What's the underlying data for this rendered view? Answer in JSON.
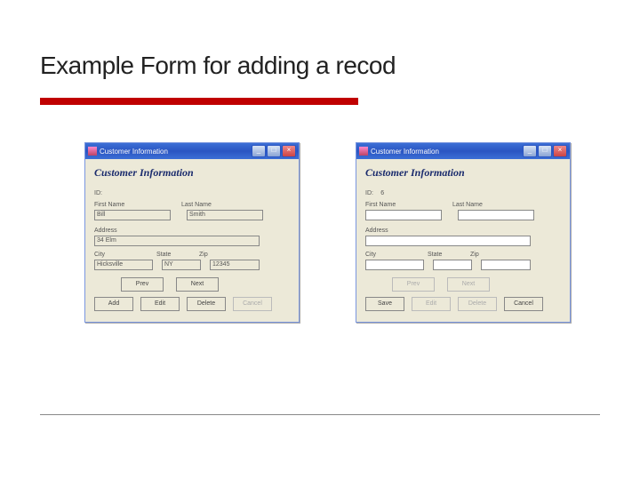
{
  "slide": {
    "title": "Example Form for adding a recod"
  },
  "leftForm": {
    "window_title": "Customer Information",
    "heading": "Customer Information",
    "labels": {
      "id": "ID:",
      "first_name": "First Name",
      "last_name": "Last Name",
      "address": "Address",
      "city": "City",
      "state": "State",
      "zip": "Zip"
    },
    "values": {
      "id": "",
      "first_name": "Bill",
      "last_name": "Smith",
      "address": "34 Elm",
      "city": "Hicksville",
      "state": "NY",
      "zip": "12345"
    },
    "buttons": {
      "prev": "Prev",
      "next": "Next",
      "add": "Add",
      "edit": "Edit",
      "delete": "Delete",
      "cancel": "Cancel"
    }
  },
  "rightForm": {
    "window_title": "Customer Information",
    "heading": "Customer Information",
    "labels": {
      "id": "ID:",
      "first_name": "First Name",
      "last_name": "Last Name",
      "address": "Address",
      "city": "City",
      "state": "State",
      "zip": "Zip"
    },
    "values": {
      "id": "6",
      "first_name": "",
      "last_name": "",
      "address": "",
      "city": "",
      "state": "",
      "zip": ""
    },
    "buttons": {
      "prev": "Prev",
      "next": "Next",
      "save": "Save",
      "edit": "Edit",
      "delete": "Delete",
      "cancel": "Cancel"
    }
  }
}
